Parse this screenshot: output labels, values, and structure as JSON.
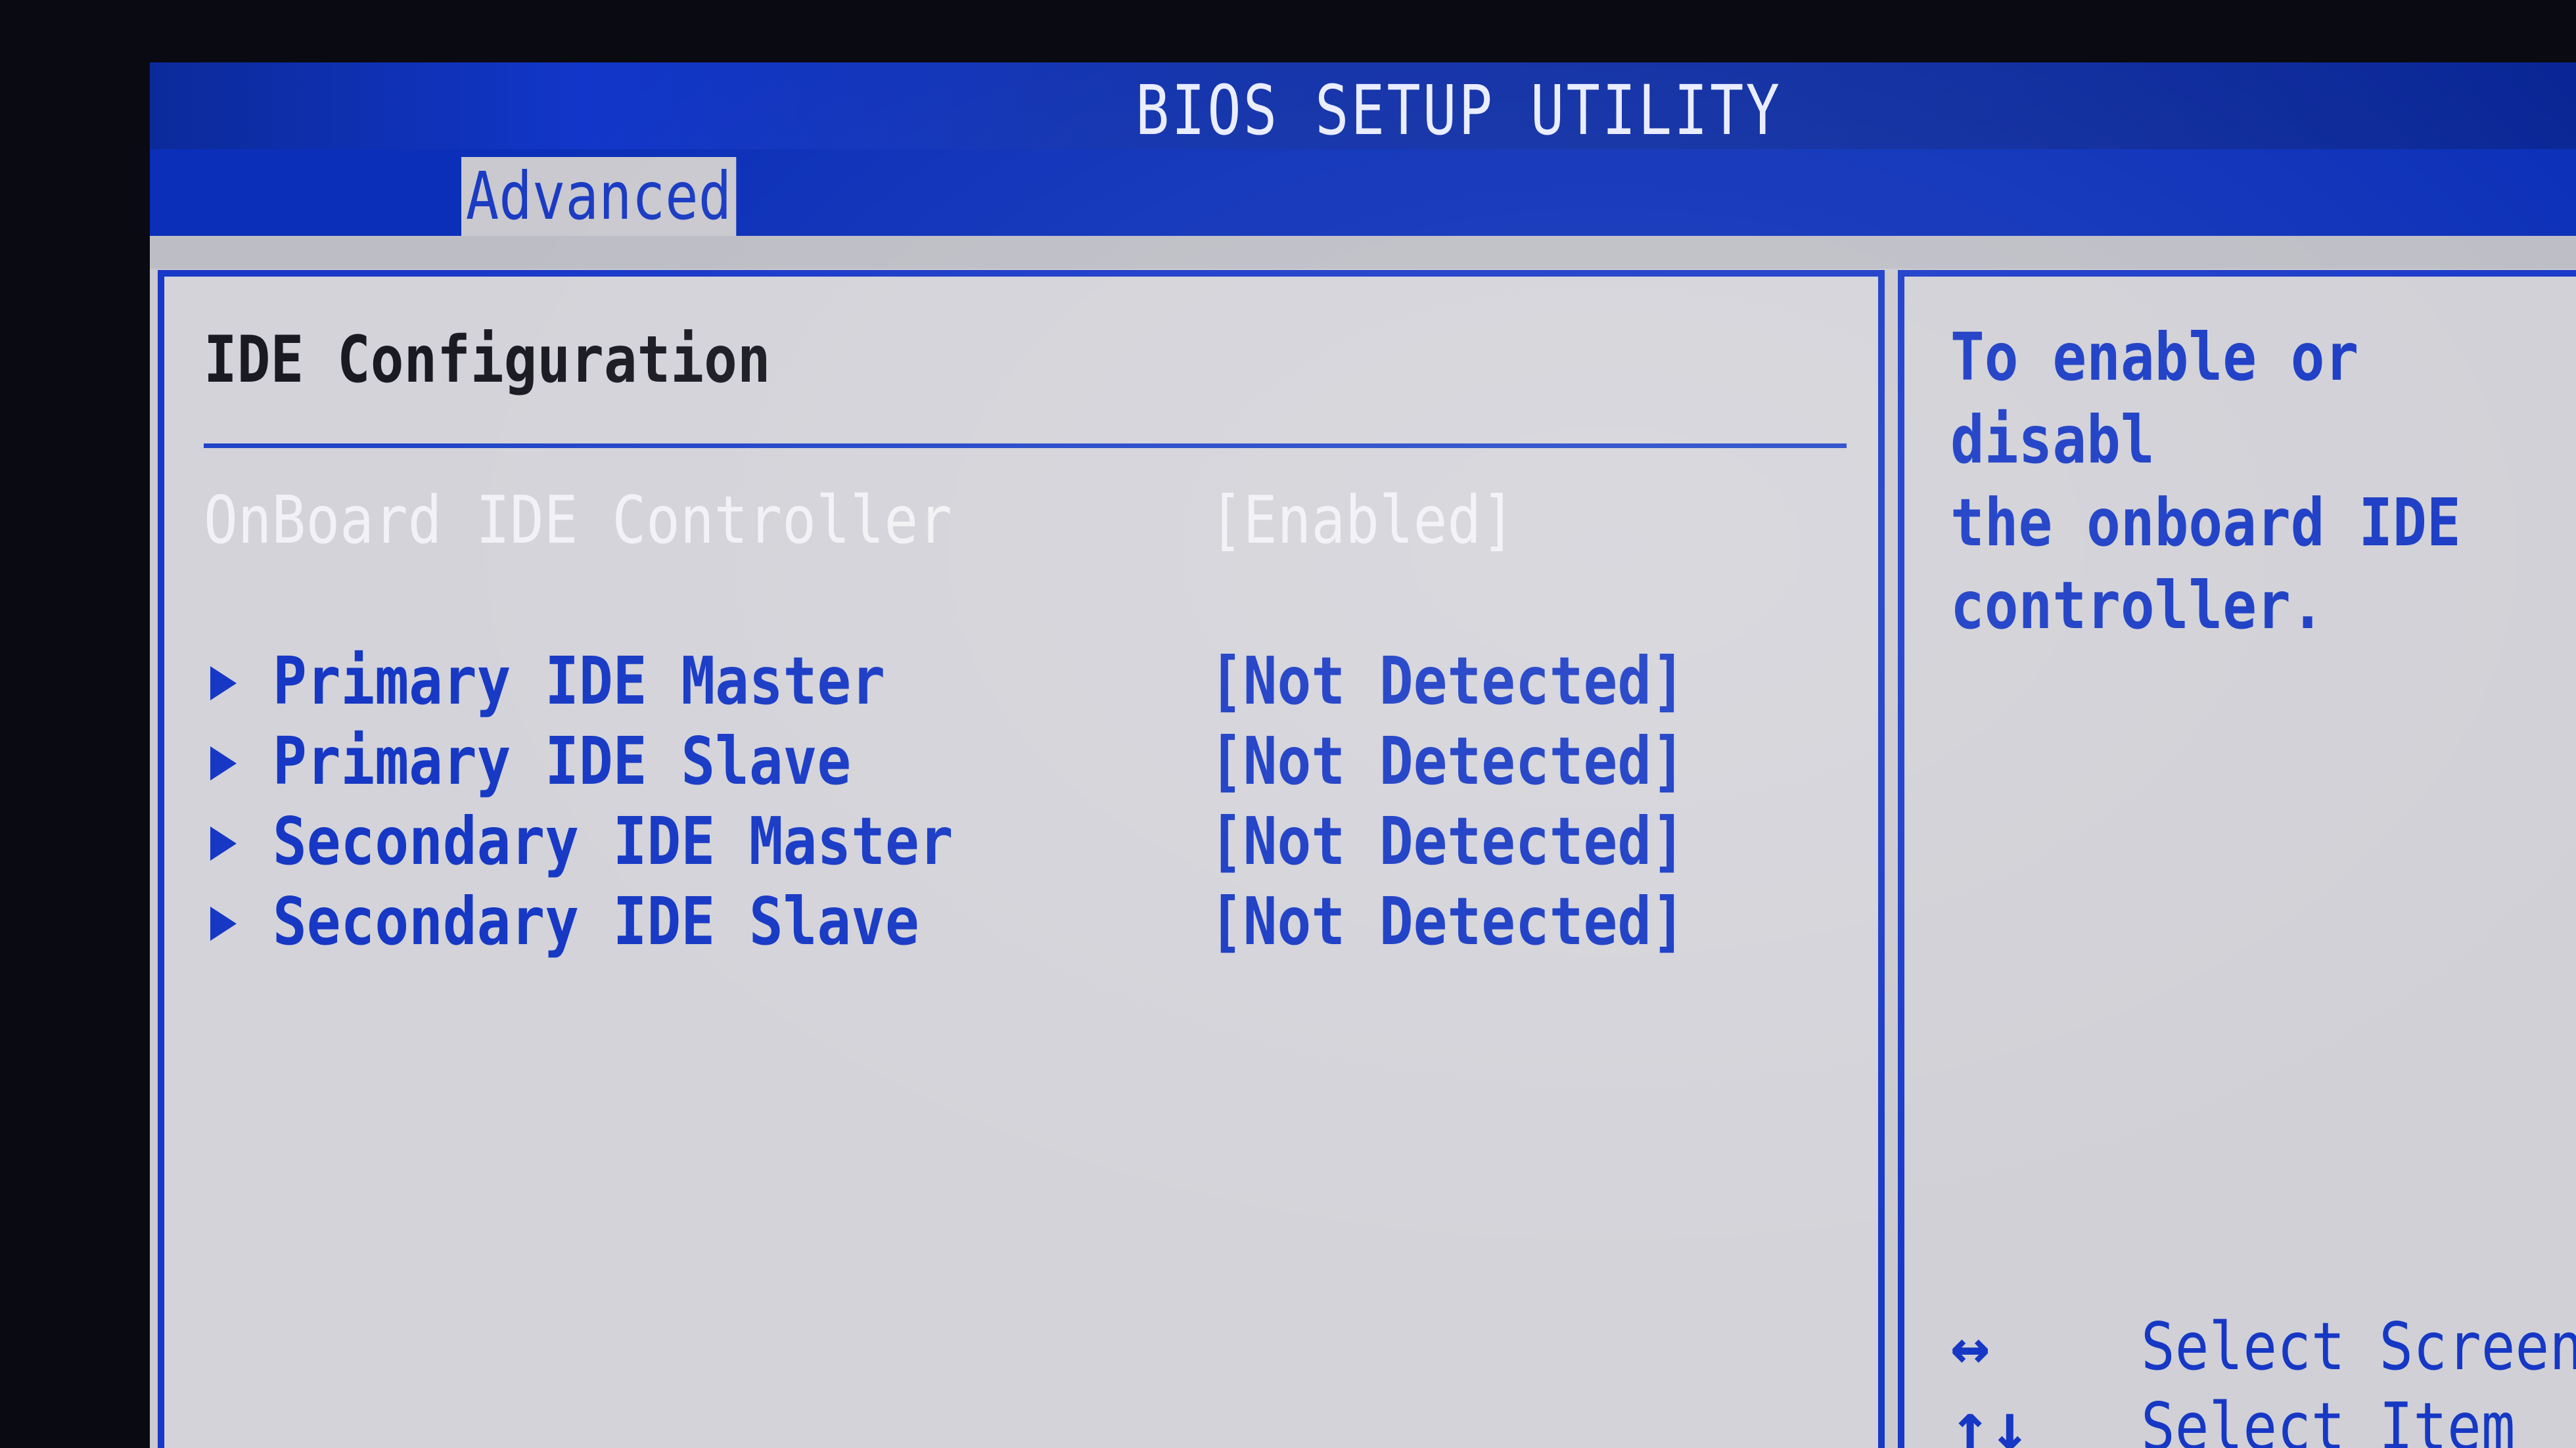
{
  "header": {
    "title": "BIOS SETUP UTILITY",
    "active_tab": "Advanced"
  },
  "main": {
    "section_title": "IDE Configuration",
    "items": [
      {
        "label": "OnBoard IDE Controller",
        "value": "[Enabled]"
      },
      {
        "label": "Primary IDE Master",
        "value": "[Not Detected]"
      },
      {
        "label": "Primary IDE Slave",
        "value": "[Not Detected]"
      },
      {
        "label": "Secondary IDE Master",
        "value": "[Not Detected]"
      },
      {
        "label": "Secondary IDE Slave",
        "value": "[Not Detected]"
      }
    ]
  },
  "help": {
    "text": "To enable or disabl\nthe onboard IDE\ncontroller.",
    "keys": [
      {
        "key": "↔",
        "desc": "Select Screen"
      },
      {
        "key": "↑↓",
        "desc": "Select Item"
      }
    ]
  },
  "colors": {
    "title_bar": "#0b2a9a",
    "panel_border": "#1838c8",
    "panel_bg": "#d3d3d9",
    "item_text": "#1638c4",
    "selected_text": "#f2f2f6"
  }
}
